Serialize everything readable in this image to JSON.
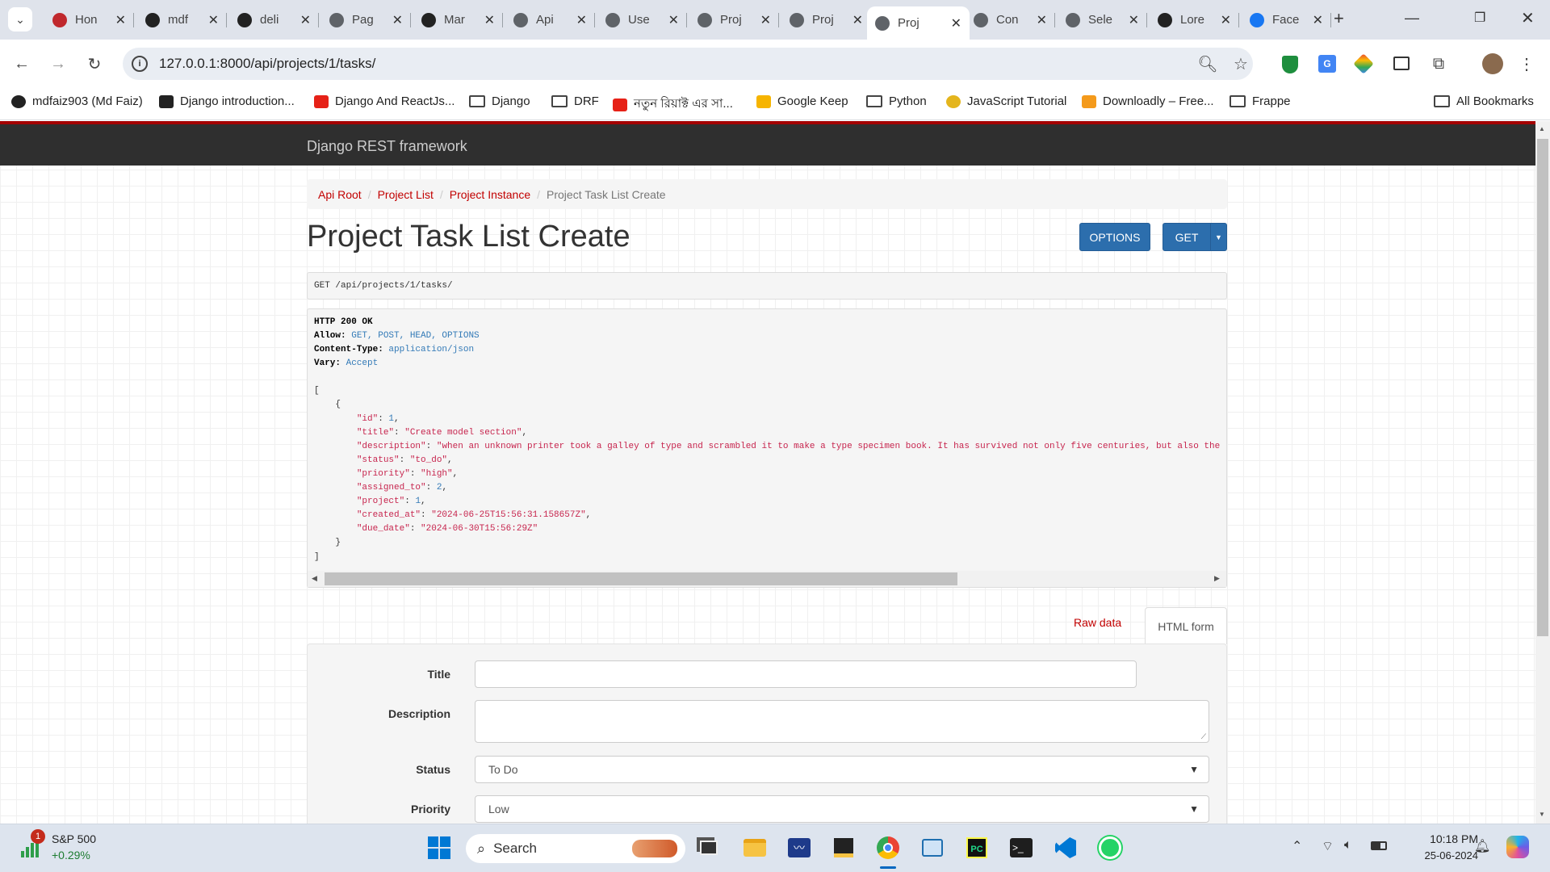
{
  "browser": {
    "tabs": [
      {
        "title": "Hon",
        "icon": "red-dot-icon",
        "color": "#c0282d"
      },
      {
        "title": "mdf",
        "icon": "github-icon",
        "color": "#222"
      },
      {
        "title": "deli",
        "icon": "github-icon",
        "color": "#222"
      },
      {
        "title": "Pag",
        "icon": "globe-icon",
        "color": "#5f6368"
      },
      {
        "title": "Mar",
        "icon": "m-logo-icon",
        "color": "#222"
      },
      {
        "title": "Api",
        "icon": "globe-icon",
        "color": "#5f6368"
      },
      {
        "title": "Use",
        "icon": "globe-icon",
        "color": "#5f6368"
      },
      {
        "title": "Proj",
        "icon": "globe-icon",
        "color": "#5f6368"
      },
      {
        "title": "Proj",
        "icon": "globe-icon",
        "color": "#5f6368"
      },
      {
        "title": "Proj",
        "icon": "globe-icon",
        "color": "#5f6368",
        "active": true
      },
      {
        "title": "Con",
        "icon": "globe-icon",
        "color": "#5f6368"
      },
      {
        "title": "Sele",
        "icon": "globe-icon",
        "color": "#5f6368"
      },
      {
        "title": "Lore",
        "icon": "l-logo-icon",
        "color": "#222"
      },
      {
        "title": "Face",
        "icon": "facebook-icon",
        "color": "#1877f2"
      }
    ],
    "url": "127.0.0.1:8000/api/projects/1/tasks/",
    "bookmarks": [
      {
        "label": "mdfaiz903 (Md Faiz)",
        "icon": "github-icon"
      },
      {
        "label": "Django introduction...",
        "icon": "m-logo-icon"
      },
      {
        "label": "Django And ReactJs...",
        "icon": "youtube-icon"
      },
      {
        "label": "Django",
        "icon": "folder-icon"
      },
      {
        "label": "DRF",
        "icon": "folder-icon"
      },
      {
        "label": "নতুন রিয়াক্ট এর সা...",
        "icon": "youtube-icon"
      },
      {
        "label": "Google Keep",
        "icon": "keep-icon"
      },
      {
        "label": "Python",
        "icon": "folder-icon"
      },
      {
        "label": "JavaScript Tutorial",
        "icon": "js-icon"
      },
      {
        "label": "Downloadly – Free...",
        "icon": "downloadly-icon"
      },
      {
        "label": "Frappe",
        "icon": "folder-icon"
      }
    ],
    "all_bookmarks": "All Bookmarks"
  },
  "drf": {
    "brand": "Django REST framework",
    "breadcrumbs": [
      "Api Root",
      "Project List",
      "Project Instance"
    ],
    "breadcrumb_current": "Project Task List Create",
    "title": "Project Task List Create",
    "options_label": "OPTIONS",
    "get_label": "GET",
    "request_line": "GET /api/projects/1/tasks/",
    "response": {
      "status": "HTTP 200 OK",
      "headers": [
        {
          "key": "Allow",
          "value": "GET, POST, HEAD, OPTIONS"
        },
        {
          "key": "Content-Type",
          "value": "application/json"
        },
        {
          "key": "Vary",
          "value": "Accept"
        }
      ],
      "json_fields": [
        {
          "key": "\"id\"",
          "value": "1",
          "type": "num"
        },
        {
          "key": "\"title\"",
          "value": "\"Create model section\"",
          "type": "str"
        },
        {
          "key": "\"description\"",
          "value": "\"when an unknown printer took a galley of type and scrambled it to make a type specimen book. It has survived not only five centuries, but also the l",
          "type": "str",
          "truncated": true
        },
        {
          "key": "\"status\"",
          "value": "\"to_do\"",
          "type": "str"
        },
        {
          "key": "\"priority\"",
          "value": "\"high\"",
          "type": "str"
        },
        {
          "key": "\"assigned_to\"",
          "value": "2",
          "type": "num"
        },
        {
          "key": "\"project\"",
          "value": "1",
          "type": "num"
        },
        {
          "key": "\"created_at\"",
          "value": "\"2024-06-25T15:56:31.158657Z\"",
          "type": "str"
        },
        {
          "key": "\"due_date\"",
          "value": "\"2024-06-30T15:56:29Z\"",
          "type": "str",
          "last": true
        }
      ]
    },
    "raw_data_tab": "Raw data",
    "html_form_tab": "HTML form",
    "form": {
      "title_label": "Title",
      "description_label": "Description",
      "status_label": "Status",
      "status_value": "To Do",
      "priority_label": "Priority",
      "priority_value": "Low"
    }
  },
  "taskbar": {
    "stock_name": "S&P 500",
    "stock_change": "+0.29%",
    "stock_badge": "1",
    "search_placeholder": "Search",
    "time": "10:18 PM",
    "date": "25-06-2024"
  },
  "colors": {
    "drf_red": "#c20000",
    "drf_blue": "#2c6ead",
    "navbar": "#2f2f2f",
    "json_string": "#c7254e"
  }
}
